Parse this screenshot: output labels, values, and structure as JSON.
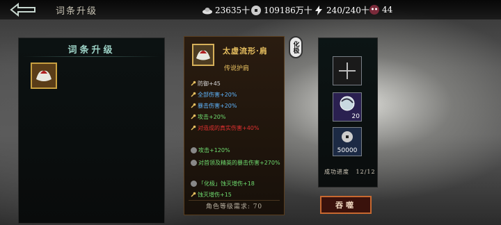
{
  "header": {
    "title": "词条升级",
    "resources": [
      {
        "icon": "silver-ingot-icon",
        "value": "23635十"
      },
      {
        "icon": "copper-coin-icon",
        "value": "109186万十"
      },
      {
        "icon": "lightning-icon",
        "value": "240/240十"
      },
      {
        "icon": "demon-mask-icon",
        "value": "44"
      }
    ]
  },
  "left_panel": {
    "title": "词条升级"
  },
  "item_card": {
    "name": "太虚流形·肩",
    "type": "传说护肩",
    "badge": "化极",
    "stats": [
      {
        "text": "防御+45",
        "color": "#d8d8d8",
        "icon": "key-icon"
      },
      {
        "text": "全部伤害+20%",
        "color": "#5fb6ff",
        "icon": "key-icon"
      },
      {
        "text": "暴击伤害+20%",
        "color": "#5fb6ff",
        "icon": "key-icon"
      },
      {
        "text": "攻击+20%",
        "color": "#6fdc6f",
        "icon": "key-icon"
      },
      {
        "text": "对造成的真实伤害+40%",
        "color": "#e03030",
        "icon": "key-icon"
      },
      {
        "text": "攻击+120%",
        "color": "#6fdc6f",
        "icon": "circle-icon"
      },
      {
        "text": "对首领及精英的暴击伤害+270%",
        "color": "#6fdc6f",
        "icon": "circle-icon"
      },
      {
        "text": "「化极」蚀灭增伤+18",
        "color": "#6fdc6f",
        "icon": "circle-icon"
      },
      {
        "text": "蚀灭增伤+15",
        "color": "#6fdc6f",
        "icon": "key-icon"
      }
    ],
    "requirement": "角色等级需求: 70"
  },
  "right_panel": {
    "material_count": "20",
    "cost": "50000",
    "progress_label": "成功进度",
    "progress_value": "12/12"
  },
  "actions": {
    "devour_label": "吞噬"
  }
}
